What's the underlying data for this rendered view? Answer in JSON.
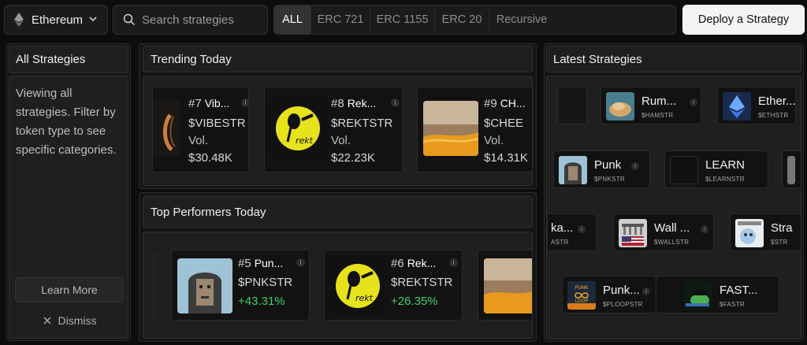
{
  "topbar": {
    "chain_label": "Ethereum",
    "search_placeholder": "Search strategies",
    "filters": [
      "ALL",
      "ERC 721",
      "ERC 1155",
      "ERC 20",
      "Recursive"
    ],
    "deploy_label": "Deploy a Strategy"
  },
  "left": {
    "title": "All Strategies",
    "description": "Viewing all strategies. Filter by token type to see specific categories.",
    "learn_more": "Learn More",
    "dismiss": "Dismiss"
  },
  "trending": {
    "title": "Trending Today",
    "cards": [
      {
        "rank": "#7",
        "name": "Vib...",
        "ticker": "$VIBESTR",
        "vol_label": "Vol.",
        "volume": "$30.48K"
      },
      {
        "rank": "#8",
        "name": "Rek...",
        "ticker": "$REKTSTR",
        "vol_label": "Vol.",
        "volume": "$22.23K"
      },
      {
        "rank": "#9",
        "name": "CH...",
        "ticker": "$CHEE",
        "vol_label": "Vol.",
        "volume": "$14.31K"
      }
    ]
  },
  "top_performers": {
    "title": "Top Performers Today",
    "cards": [
      {
        "rank": "#5",
        "name": "Pun...",
        "ticker": "$PNKSTR",
        "change": "+43.31%"
      },
      {
        "rank": "#6",
        "name": "Rek...",
        "ticker": "$REKTSTR",
        "change": "+26.35%"
      }
    ]
  },
  "latest": {
    "title": "Latest Strategies",
    "items": [
      {
        "name": "Rum...",
        "symbol": "$HAMSTR"
      },
      {
        "name": "Ether...",
        "symbol": "$ETHSTR"
      },
      {
        "name": "Punk",
        "symbol": "$PNKSTR"
      },
      {
        "name": "LEARN",
        "symbol": "$LEARNSTR"
      },
      {
        "name": "ka...",
        "symbol": "ASTR"
      },
      {
        "name": "Wall ...",
        "symbol": "$WALLSTR"
      },
      {
        "name": "Stra",
        "symbol": "$STR"
      },
      {
        "name": "Punk...",
        "symbol": "$PLOOPSTR"
      },
      {
        "name": "FAST...",
        "symbol": "$FASTR"
      }
    ],
    "punk_loop_logo": "PUNK LOOP",
    "mini_logo_text": "rekt"
  },
  "colors": {
    "positive": "#3fcf6a",
    "rekt_yellow": "#e6e21c",
    "background": "#0d0d0d"
  }
}
